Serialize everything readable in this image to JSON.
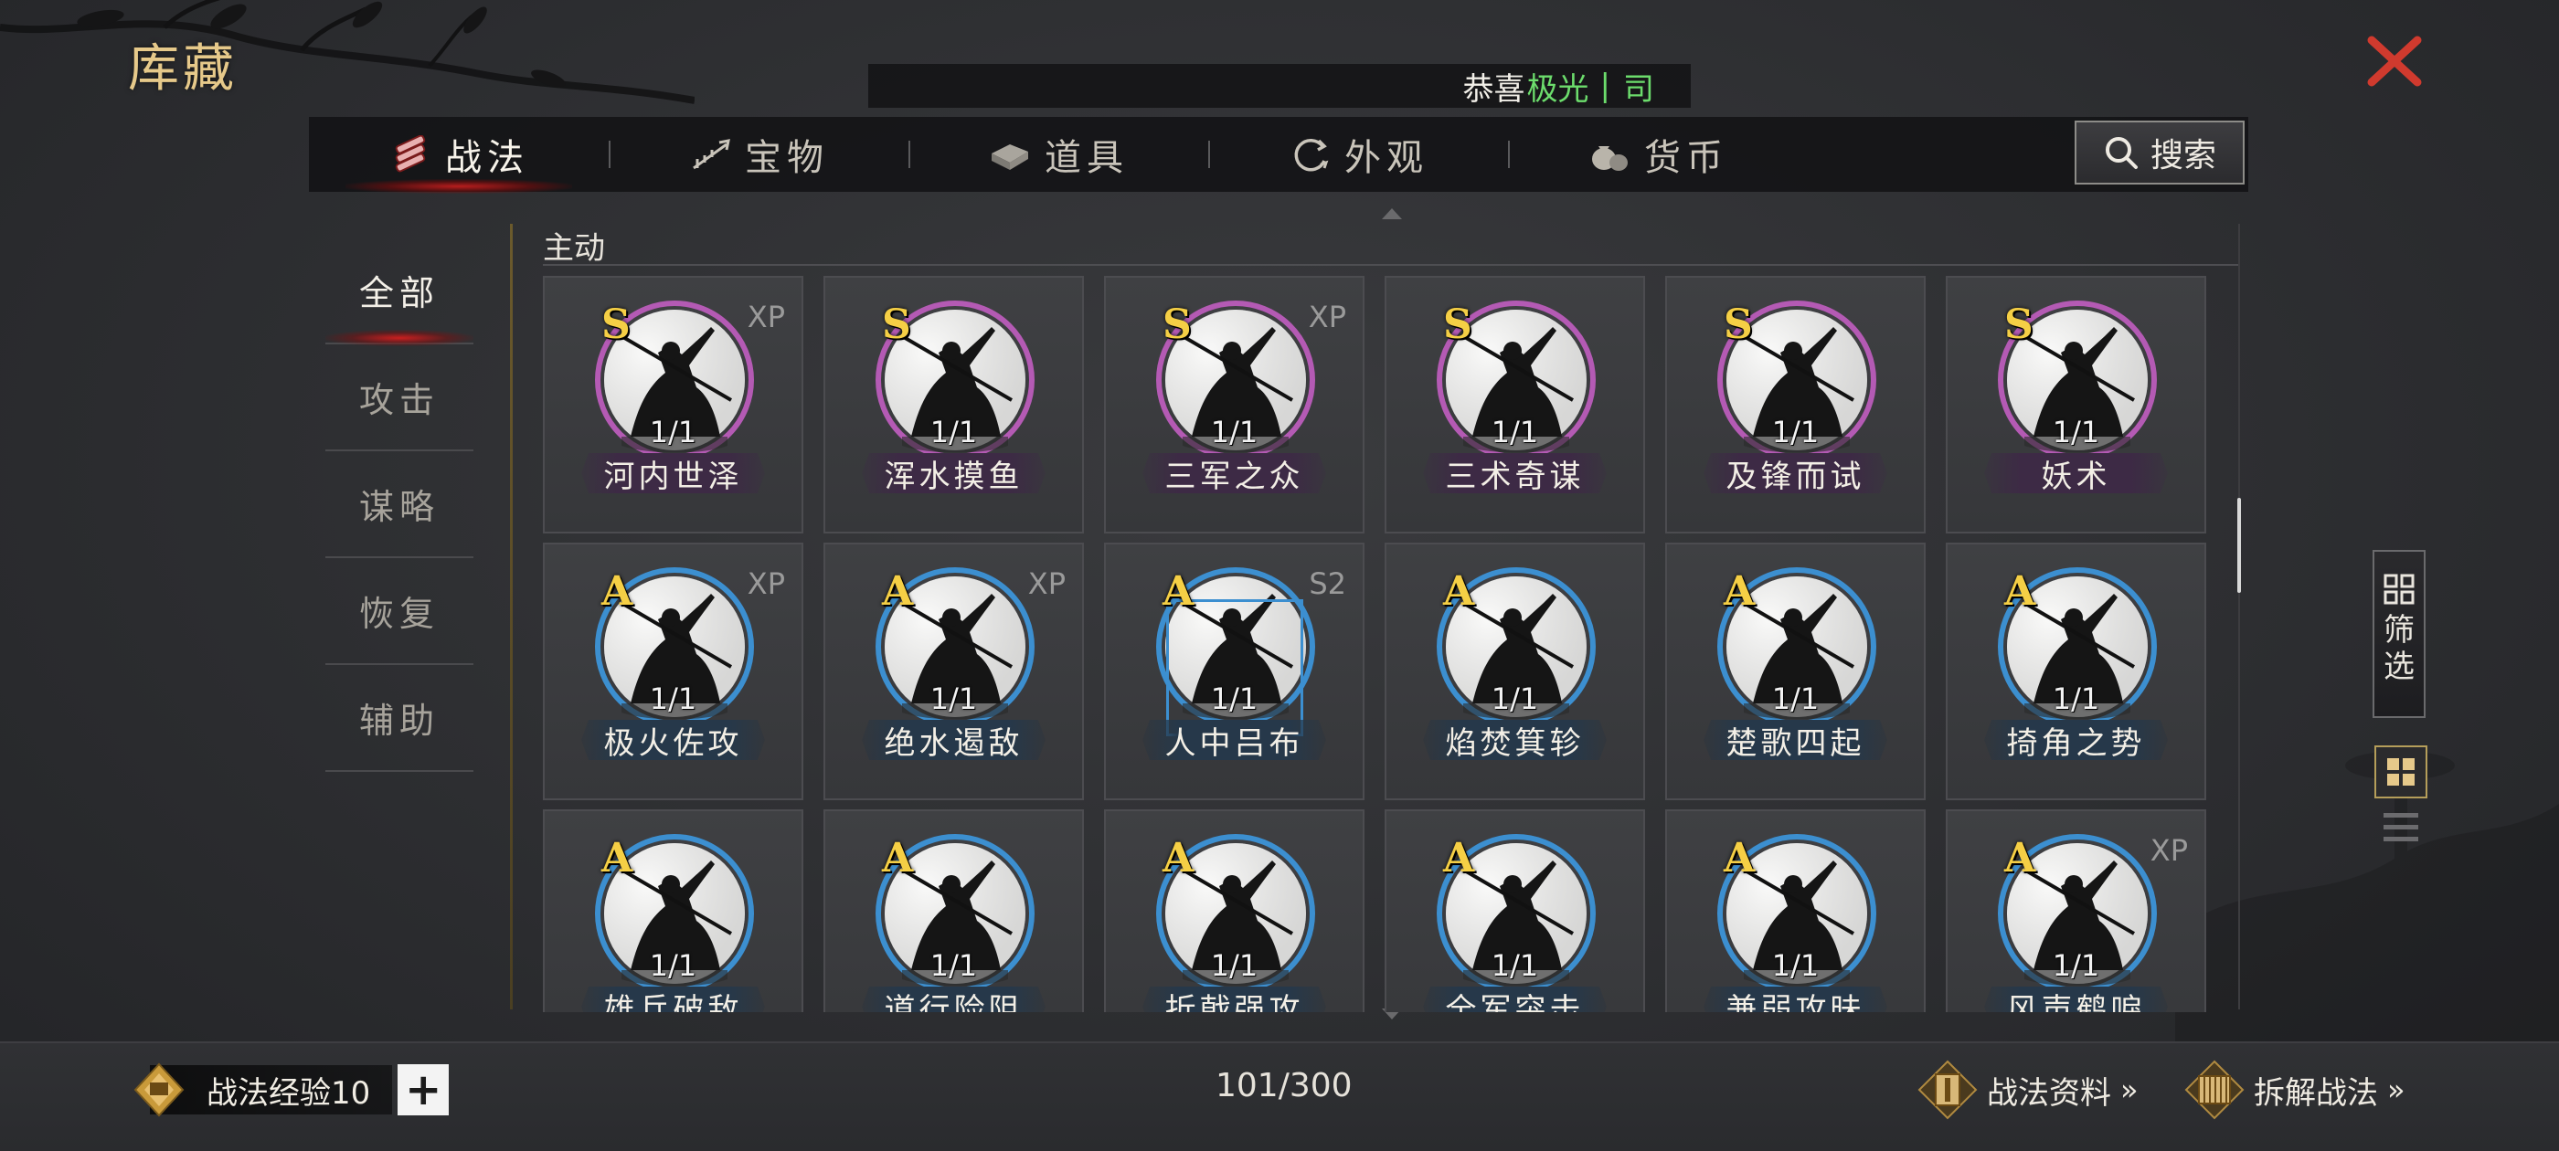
{
  "window": {
    "title": "库藏",
    "close_icon": "close-x-icon"
  },
  "notice": {
    "prefix": "恭喜",
    "highlight": "极光",
    "separator": "|",
    "suffix": "司"
  },
  "tabs": [
    {
      "label": "战法",
      "icon": "tactics-icon",
      "active": true
    },
    {
      "label": "宝物",
      "icon": "treasure-icon",
      "active": false
    },
    {
      "label": "道具",
      "icon": "item-icon",
      "active": false
    },
    {
      "label": "外观",
      "icon": "appearance-icon",
      "active": false
    },
    {
      "label": "货币",
      "icon": "currency-icon",
      "active": false
    }
  ],
  "search": {
    "label": "搜索"
  },
  "categories": [
    {
      "label": "全部",
      "active": true
    },
    {
      "label": "攻击",
      "active": false
    },
    {
      "label": "谋略",
      "active": false
    },
    {
      "label": "恢复",
      "active": false
    },
    {
      "label": "辅助",
      "active": false
    }
  ],
  "section": {
    "title": "主动"
  },
  "cards": [
    {
      "name": "河内世泽",
      "grade": "S",
      "count": "1/1",
      "tag": "XP"
    },
    {
      "name": "浑水摸鱼",
      "grade": "S",
      "count": "1/1",
      "tag": ""
    },
    {
      "name": "三军之众",
      "grade": "S",
      "count": "1/1",
      "tag": "XP"
    },
    {
      "name": "三术奇谋",
      "grade": "S",
      "count": "1/1",
      "tag": ""
    },
    {
      "name": "及锋而试",
      "grade": "S",
      "count": "1/1",
      "tag": ""
    },
    {
      "name": "妖术",
      "grade": "S",
      "count": "1/1",
      "tag": ""
    },
    {
      "name": "极火佐攻",
      "grade": "A",
      "count": "1/1",
      "tag": "XP"
    },
    {
      "name": "绝水遏敌",
      "grade": "A",
      "count": "1/1",
      "tag": "XP"
    },
    {
      "name": "人中吕布",
      "grade": "A",
      "count": "1/1",
      "tag": "S2"
    },
    {
      "name": "焰焚箕轸",
      "grade": "A",
      "count": "1/1",
      "tag": ""
    },
    {
      "name": "楚歌四起",
      "grade": "A",
      "count": "1/1",
      "tag": ""
    },
    {
      "name": "掎角之势",
      "grade": "A",
      "count": "1/1",
      "tag": ""
    },
    {
      "name": "雄兵破敌",
      "grade": "A",
      "count": "1/1",
      "tag": ""
    },
    {
      "name": "道行险阻",
      "grade": "A",
      "count": "1/1",
      "tag": ""
    },
    {
      "name": "折戟强攻",
      "grade": "A",
      "count": "1/1",
      "tag": ""
    },
    {
      "name": "全军突击",
      "grade": "A",
      "count": "1/1",
      "tag": ""
    },
    {
      "name": "兼弱攻昧",
      "grade": "A",
      "count": "1/1",
      "tag": ""
    },
    {
      "name": "风声鹤唳",
      "grade": "A",
      "count": "1/1",
      "tag": "XP"
    }
  ],
  "side_tools": {
    "filter_label": "筛选"
  },
  "footer": {
    "exp_label": "战法经验10",
    "plus_label": "+",
    "capacity": "101/300",
    "info_link": "战法资料",
    "dismantle_link": "拆解战法",
    "chevrons": "»"
  },
  "colors": {
    "accent_gold": "#e6c98a",
    "tab_active_glow": "#c81e1e",
    "notice_highlight": "#6cdc6c",
    "grade_s_ring": "#b45ab4",
    "grade_a_ring": "#3c8fd0",
    "grade_text": "#f5cf45"
  }
}
